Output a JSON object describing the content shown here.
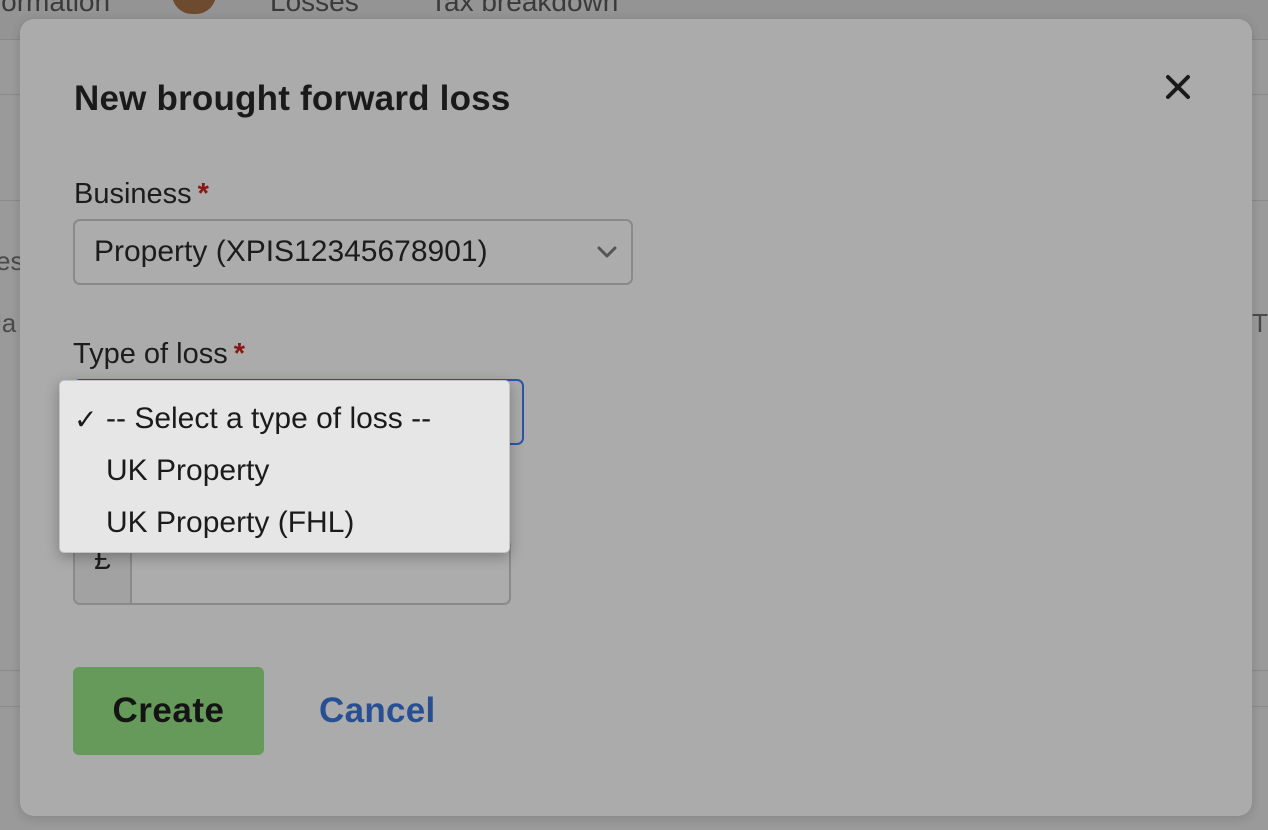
{
  "background": {
    "tabs": [
      "Information",
      "Losses",
      "Tax breakdown"
    ],
    "side_left_1": "es",
    "side_left_2": "la",
    "side_right": "T"
  },
  "modal": {
    "title": "New brought forward loss",
    "close_icon": "close-icon"
  },
  "form": {
    "business": {
      "label": "Business",
      "required_mark": "*",
      "selected": "Property (XPIS12345678901)"
    },
    "type_of_loss": {
      "label": "Type of loss",
      "required_mark": "*",
      "options": [
        {
          "label": "-- Select a type of loss --",
          "checked": true,
          "check_mark": "✓"
        },
        {
          "label": "UK Property",
          "checked": false
        },
        {
          "label": "UK Property (FHL)",
          "checked": false
        }
      ]
    },
    "amount": {
      "currency_symbol": "£",
      "value": ""
    }
  },
  "actions": {
    "create_label": "Create",
    "cancel_label": "Cancel"
  },
  "colors": {
    "create_button": "#659a5a",
    "cancel_link": "#274f94",
    "required": "#8b1414",
    "focus_border": "#2b55a8"
  }
}
